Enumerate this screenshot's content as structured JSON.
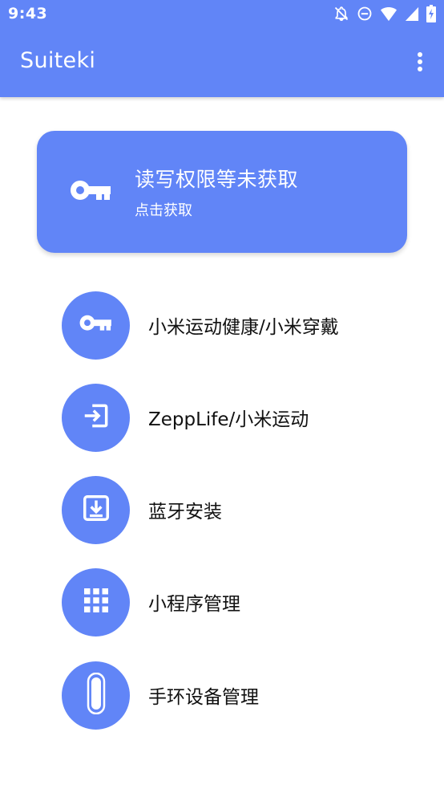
{
  "status_bar": {
    "time": "9:43",
    "icons": [
      "notifications-off-icon",
      "do-not-disturb-icon",
      "wifi-icon",
      "signal-icon",
      "battery-icon"
    ]
  },
  "app_bar": {
    "title": "Suiteki",
    "menu_icon": "more-vert-icon"
  },
  "permission_card": {
    "title": "读写权限等未获取",
    "subtitle": "点击获取",
    "icon": "key-icon"
  },
  "menu": {
    "items": [
      {
        "label": "小米运动健康/小米穿戴",
        "icon": "key-icon"
      },
      {
        "label": "ZeppLife/小米运动",
        "icon": "login-icon"
      },
      {
        "label": "蓝牙安装",
        "icon": "install-icon"
      },
      {
        "label": "小程序管理",
        "icon": "apps-grid-icon"
      },
      {
        "label": "手环设备管理",
        "icon": "band-icon"
      }
    ]
  },
  "colors": {
    "primary": "#6185f7",
    "on_primary": "#ffffff",
    "text": "#111111",
    "background": "#ffffff"
  }
}
